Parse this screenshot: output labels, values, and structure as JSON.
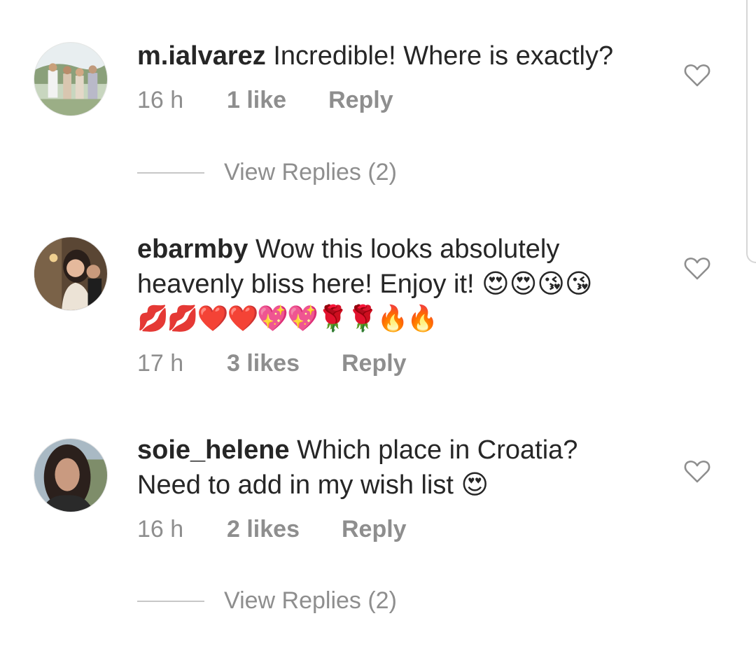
{
  "comments": [
    {
      "username": "m.ialvarez",
      "text": "Incredible! Where is exactly?",
      "text_line2": "",
      "emoji_line": "",
      "time": "16 h",
      "likes": "1 like",
      "reply_label": "Reply",
      "view_replies": "View Replies (2)"
    },
    {
      "username": "ebarmby",
      "text": "Wow this looks absolutely",
      "text_line2": "heavenly bliss here! Enjoy it! 😍😍😘😘",
      "emoji_line": "💋💋❤️❤️💖💖🌹🌹🔥🔥",
      "time": "17 h",
      "likes": "3 likes",
      "reply_label": "Reply",
      "view_replies": ""
    },
    {
      "username": "soie_helene",
      "text": "Which place in Croatia?",
      "text_line2": "Need to add in my wish list 😍",
      "emoji_line": "",
      "time": "16 h",
      "likes": "2 likes",
      "reply_label": "Reply",
      "view_replies": "View Replies (2)"
    }
  ],
  "icons": {
    "like": "heart-outline-icon"
  },
  "colors": {
    "text": "#262626",
    "secondary": "#8e8e8e",
    "divider": "#c7c7c7"
  }
}
